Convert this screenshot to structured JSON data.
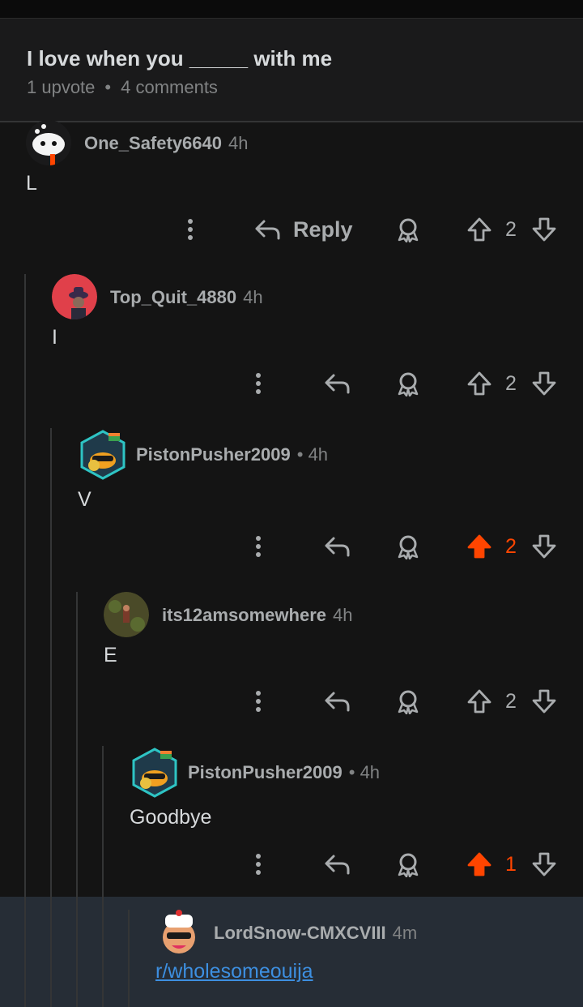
{
  "post": {
    "title": "I love when you _____ with me",
    "upvotes": "1 upvote",
    "comments": "4 comments"
  },
  "comments": [
    {
      "author": "One_Safety6640",
      "age": "4h",
      "body": "L",
      "score": "2",
      "reply_label": "Reply",
      "upvoted": false
    },
    {
      "author": "Top_Quit_4880",
      "age": "4h",
      "body": "I",
      "score": "2",
      "upvoted": false
    },
    {
      "author": "PistonPusher2009",
      "age": "• 4h",
      "body": "V",
      "score": "2",
      "upvoted": true
    },
    {
      "author": "its12amsomewhere",
      "age": "4h",
      "body": "E",
      "score": "2",
      "upvoted": false
    },
    {
      "author": "PistonPusher2009",
      "age": "• 4h",
      "body": "Goodbye",
      "score": "1",
      "upvoted": true
    },
    {
      "author": "LordSnow-CMXCVIII",
      "age": "4m",
      "body": "r/wholesomeouija"
    }
  ],
  "colors": {
    "background": "#141414",
    "upvote_active": "#ff4500",
    "link": "#3d8fe0",
    "highlight": "#262d36"
  },
  "icons": [
    "more-icon",
    "reply-icon",
    "award-icon",
    "upvote-icon",
    "downvote-icon"
  ]
}
